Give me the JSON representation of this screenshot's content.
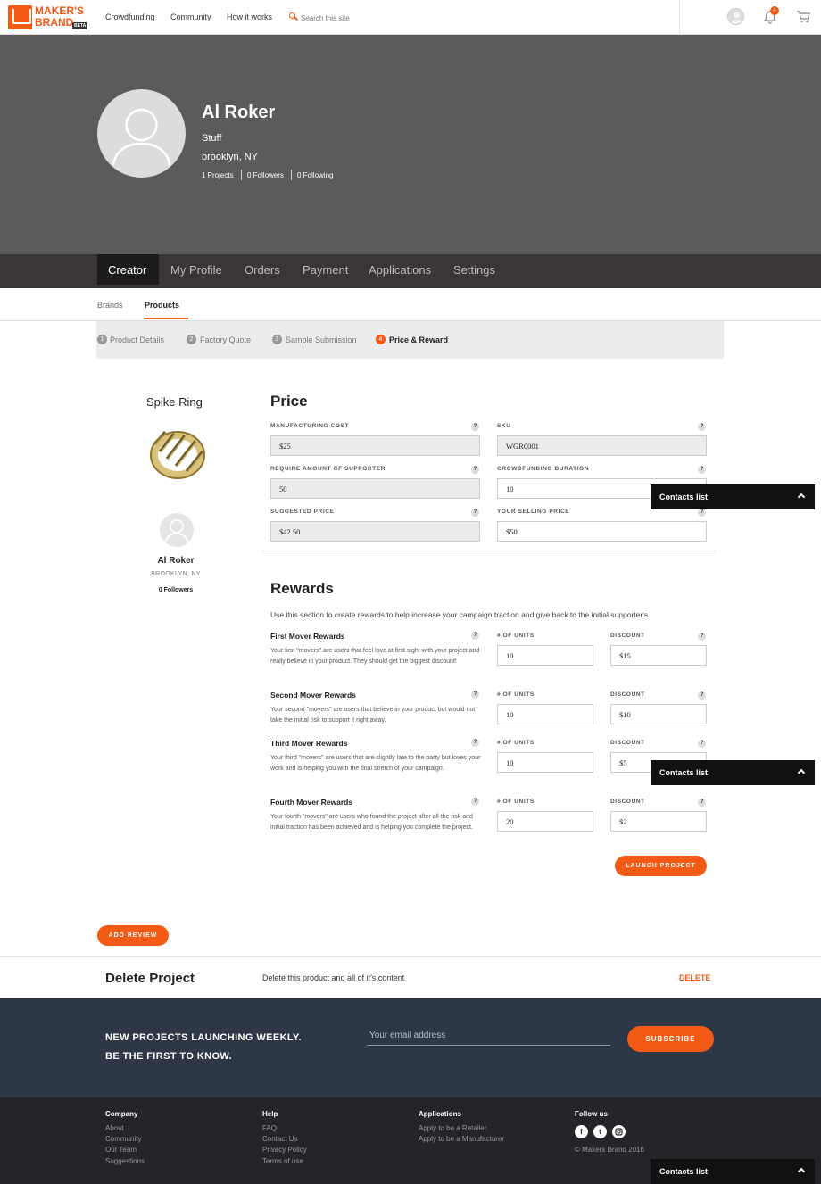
{
  "brand": {
    "logo_line1": "MAKER'S",
    "logo_line2": "BRAND",
    "beta": "BETA",
    "accent": "#f25a16"
  },
  "topnav": {
    "links": [
      "Crowdfunding",
      "Community",
      "How it works"
    ],
    "search_placeholder": "Search this site",
    "notification_count": "4"
  },
  "profile": {
    "name": "Al Roker",
    "bio": "Stuff",
    "location": "brooklyn, NY",
    "stats": [
      "1 Projects",
      "0 Followers",
      "0 Following"
    ]
  },
  "tabs": [
    "Creator",
    "My Profile",
    "Orders",
    "Payment",
    "Applications",
    "Settings"
  ],
  "subtabs": [
    "Brands",
    "Products"
  ],
  "steps": [
    {
      "num": "1",
      "label": "Product Details"
    },
    {
      "num": "2",
      "label": "Factory Quote"
    },
    {
      "num": "3",
      "label": "Sample Submission"
    },
    {
      "num": "4",
      "label": "Price & Reward"
    }
  ],
  "product": {
    "title": "Spike Ring",
    "creator_name": "Al Roker",
    "creator_location": "BROOKLYN, NY",
    "creator_followers": "0 Followers"
  },
  "price": {
    "heading": "Price",
    "manufacturing_cost": {
      "label": "MANUFACTURING COST",
      "value": "$25"
    },
    "sku": {
      "label": "SKU",
      "value": "WGR0001"
    },
    "supporters": {
      "label": "REQUIRE AMOUNT OF SUPPORTER",
      "value": "50"
    },
    "duration": {
      "label": "CROWDFUNDING DURATION",
      "value": "10"
    },
    "suggested": {
      "label": "SUGGESTED PRICE",
      "value": "$42.50"
    },
    "selling": {
      "label": "YOUR SELLING PRICE",
      "value": "$50"
    }
  },
  "rewards": {
    "heading": "Rewards",
    "description": "Use this section to create rewards to help increase your campaign traction and give back to the initial supporter's",
    "units_label": "# OF UNITS",
    "discount_label": "DISCOUNT",
    "items": [
      {
        "title": "First Mover Rewards",
        "desc": "Your first \"movers\" are users that feel love at first sight with your project and really believe in your product. They should get the biggest discount!",
        "units": "10",
        "discount": "$15"
      },
      {
        "title": "Second Mover Rewards",
        "desc": "Your second \"movers\" are users that believe in your product but would not take the initial risk to support it right away.",
        "units": "10",
        "discount": "$10"
      },
      {
        "title": "Third Mover Rewards",
        "desc": "Your third \"movers\" are users that are slightly late to the party but loves your work and is helping you with the final stretch of your campaign.",
        "units": "10",
        "discount": "$5"
      },
      {
        "title": "Fourth Mover Rewards",
        "desc": "Your fourth \"movers\" are users who found the project after all the risk and initial traction has been achieved and is helping you complete the project.",
        "units": "20",
        "discount": "$2"
      }
    ],
    "launch_label": "LAUNCH PROJECT"
  },
  "add_review_label": "ADD REVIEW",
  "delete": {
    "title": "Delete Project",
    "text": "Delete this product and all of it's content",
    "link": "DELETE"
  },
  "newsletter": {
    "line1": "NEW PROJECTS LAUNCHING WEEKLY.",
    "line2": "BE THE FIRST TO KNOW.",
    "placeholder": "Your email address",
    "button": "SUBSCRIBE"
  },
  "footer": {
    "company": {
      "head": "Company",
      "links": [
        "About",
        "Community",
        "Our Team",
        "Suggestions"
      ]
    },
    "help": {
      "head": "Help",
      "links": [
        "FAQ",
        "Contact Us",
        "Privacy Policy",
        "Terms of use"
      ]
    },
    "applications": {
      "head": "Applications",
      "links": [
        "Apply to be a Retailer",
        "Apply to be a Manufacturer"
      ]
    },
    "follow": {
      "head": "Follow us",
      "icons": [
        "facebook-icon",
        "twitter-icon",
        "instagram-icon"
      ],
      "copyright": "© Makers Brand 2016"
    }
  },
  "contacts_label": "Contacts list"
}
